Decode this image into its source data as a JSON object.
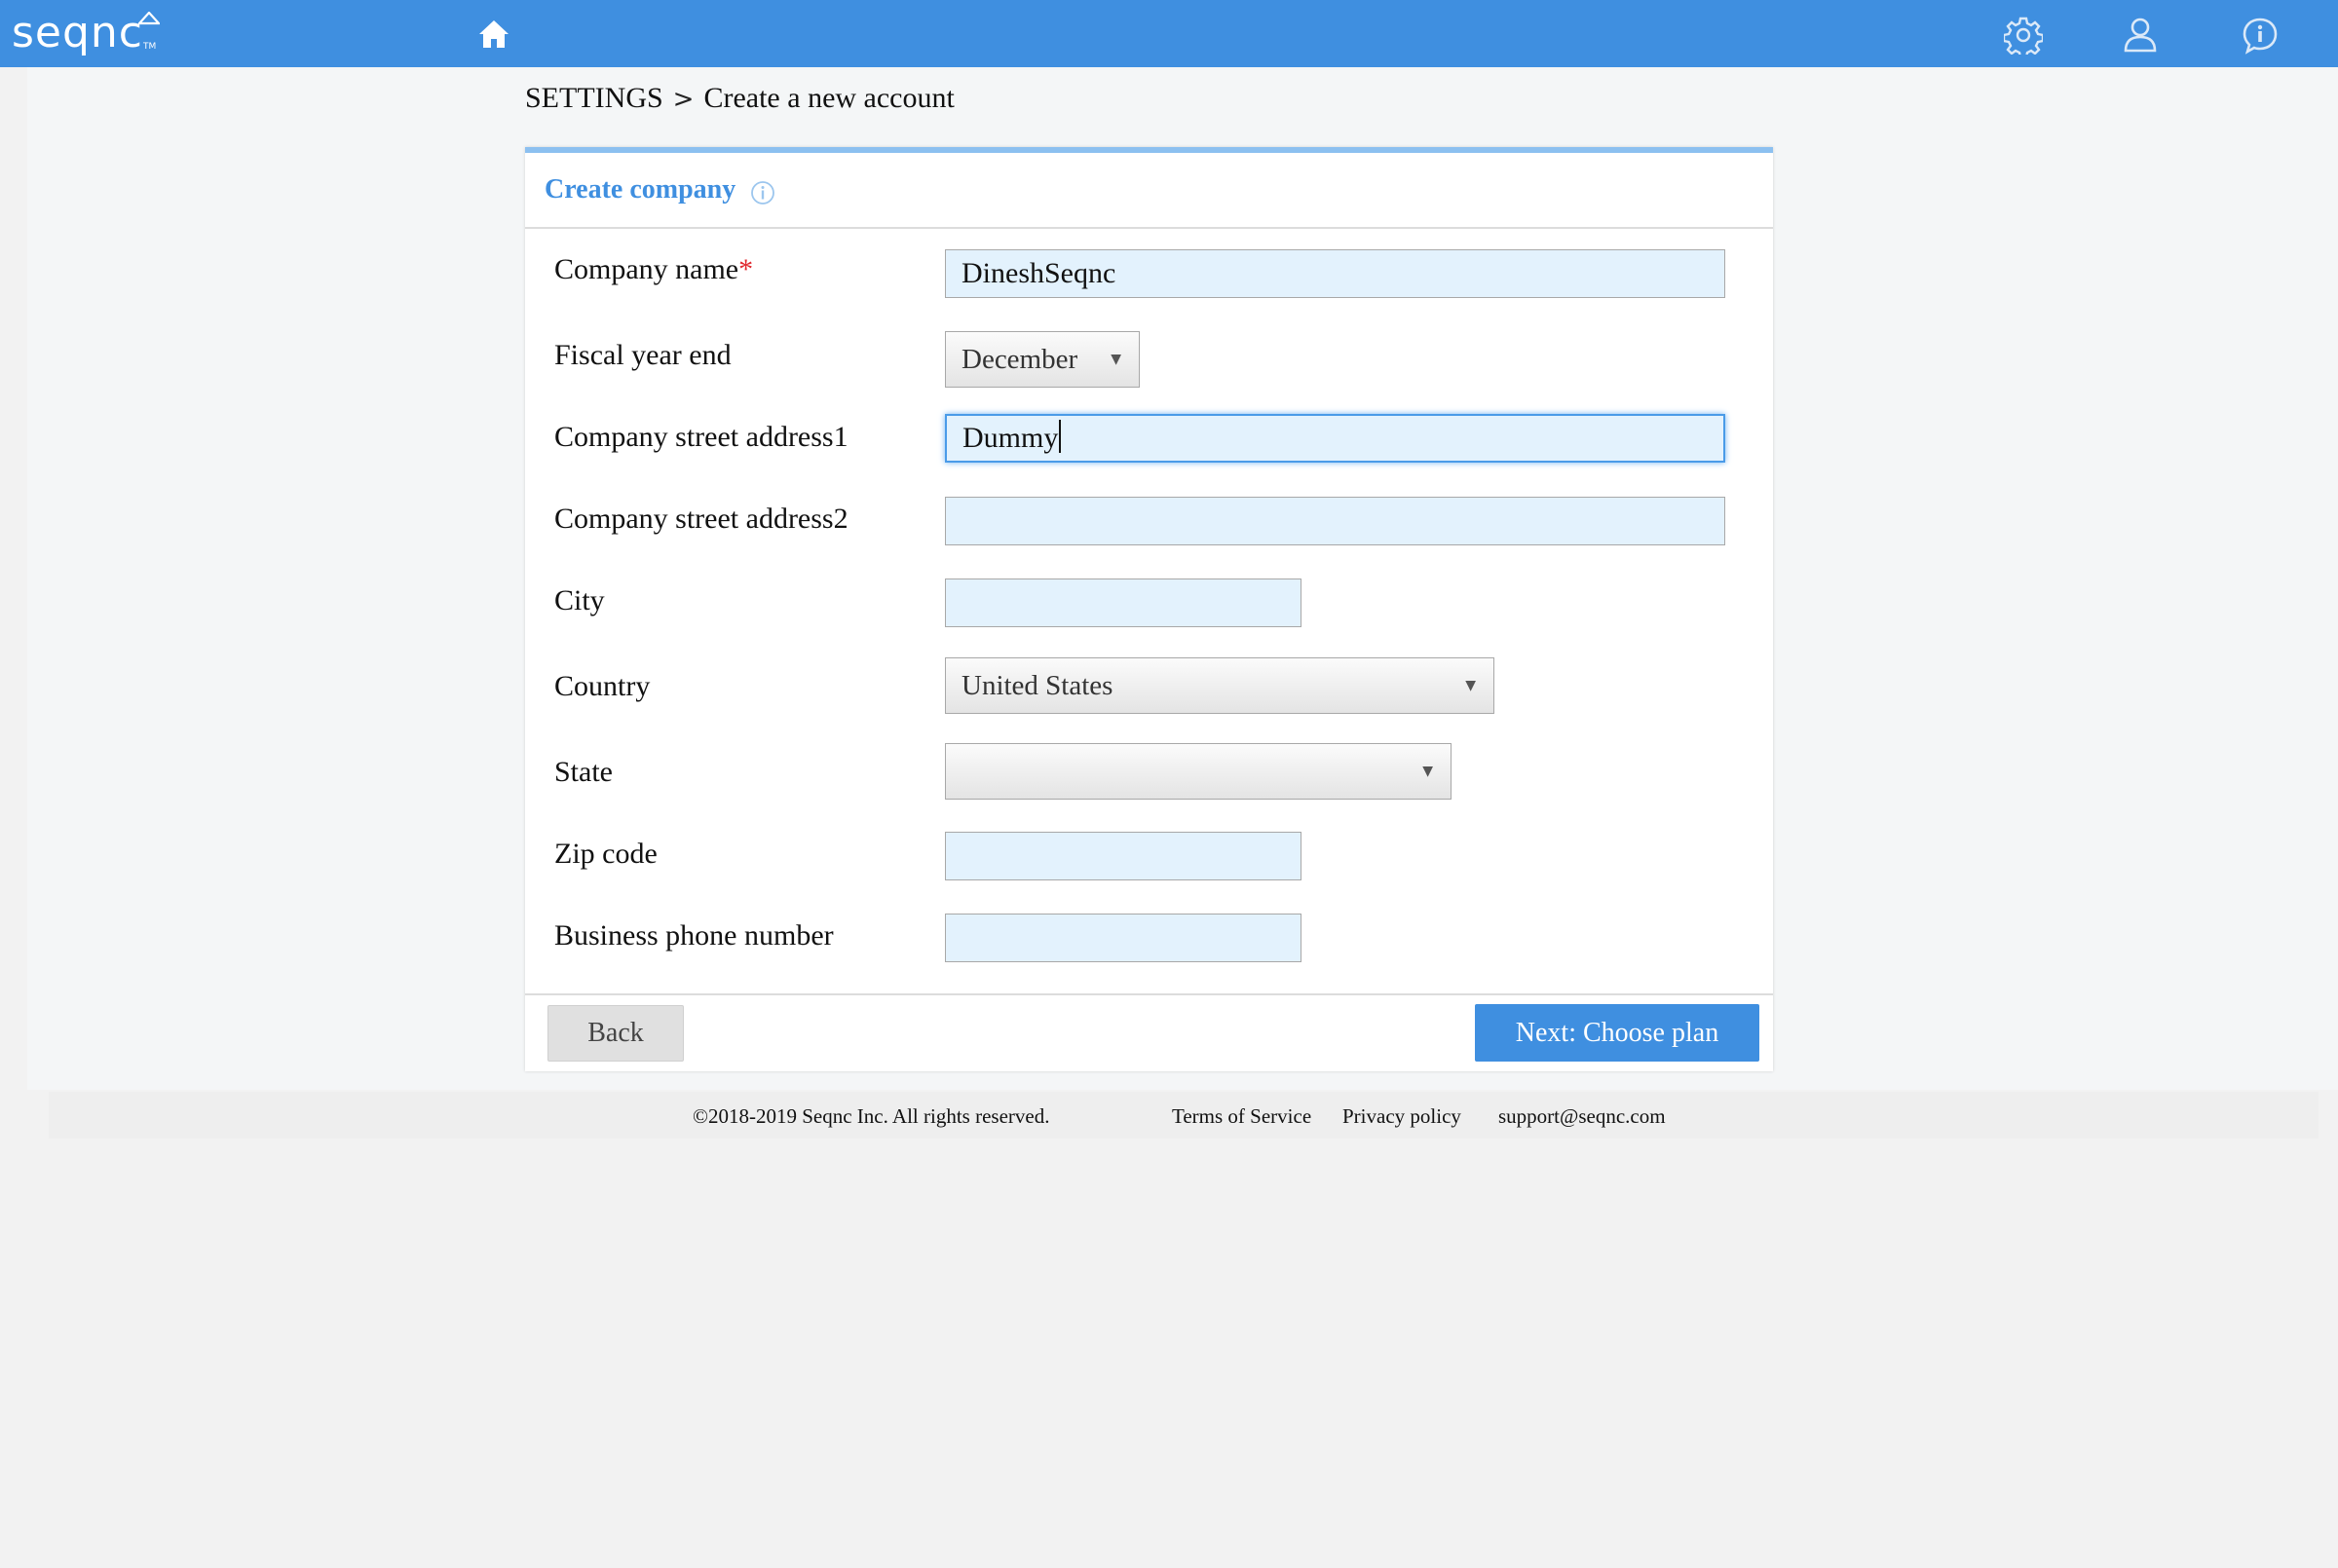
{
  "header": {
    "logo_text": "seqnc",
    "logo_tm": "TM",
    "icons": [
      "home-icon",
      "gear-icon",
      "user-icon",
      "info-icon"
    ],
    "brand_color": "#3f8fe0"
  },
  "breadcrumb": {
    "root": "SETTINGS",
    "separator": ">",
    "current": "Create a new account"
  },
  "card": {
    "title": "Create company",
    "fields": {
      "company_name": {
        "label": "Company name",
        "required_mark": "*",
        "value": "DineshSeqnc"
      },
      "fiscal_year_end": {
        "label": "Fiscal year end",
        "value": "December"
      },
      "address1": {
        "label": "Company street address1",
        "value": "Dummy"
      },
      "address2": {
        "label": "Company street address2",
        "value": ""
      },
      "city": {
        "label": "City",
        "value": ""
      },
      "country": {
        "label": "Country",
        "value": "United States"
      },
      "state": {
        "label": "State",
        "value": ""
      },
      "zip": {
        "label": "Zip code",
        "value": ""
      },
      "phone": {
        "label": "Business phone number",
        "value": ""
      }
    },
    "back_label": "Back",
    "next_label": "Next: Choose plan"
  },
  "footer": {
    "copyright": "©2018-2019 Seqnc Inc. All rights reserved.",
    "terms": "Terms of Service",
    "privacy": "Privacy policy",
    "email": "support@seqnc.com"
  }
}
